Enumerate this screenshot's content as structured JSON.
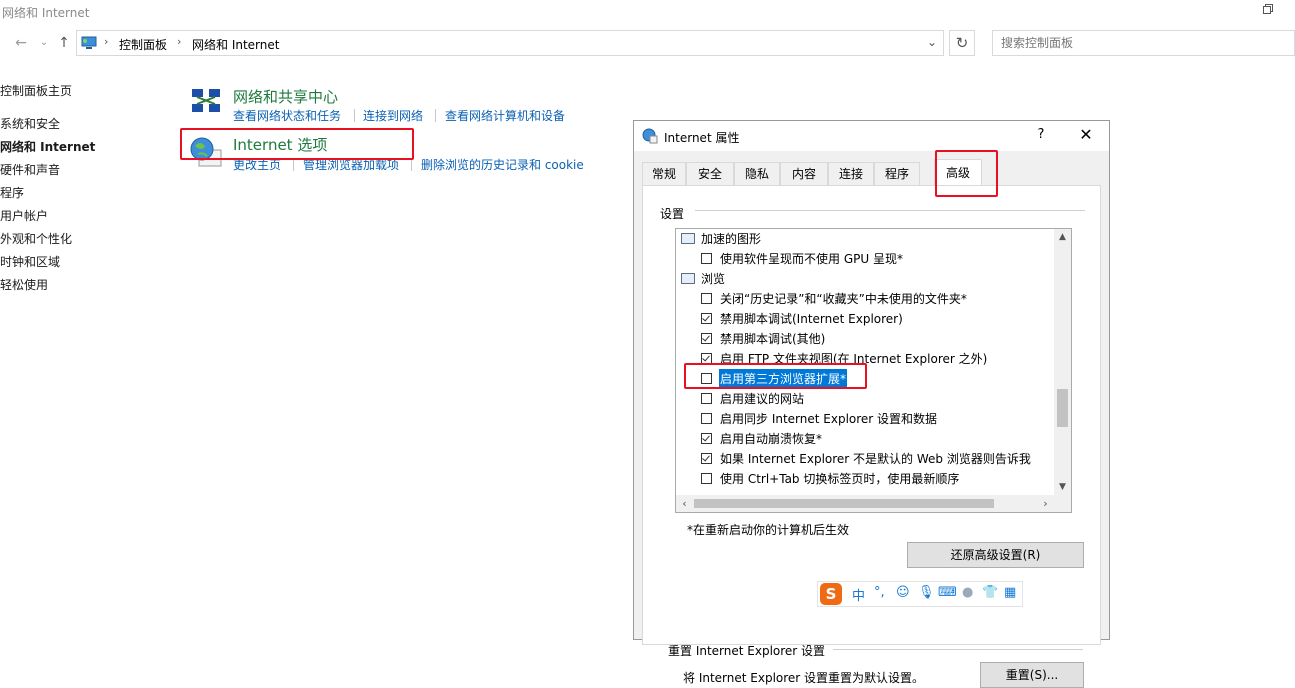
{
  "window": {
    "title": "网络和 Internet"
  },
  "address_bar": {
    "crumbs": [
      "控制面板",
      "网络和 Internet"
    ],
    "search_placeholder": "搜索控制面板"
  },
  "left_nav": {
    "items": [
      "控制面板主页",
      "系统和安全",
      "网络和 Internet",
      "硬件和声音",
      "程序",
      "用户帐户",
      "外观和个性化",
      "时钟和区域",
      "轻松使用"
    ]
  },
  "categories": [
    {
      "heading": "网络和共享中心",
      "links": [
        "查看网络状态和任务",
        "连接到网络",
        "查看网络计算机和设备"
      ]
    },
    {
      "heading": "Internet 选项",
      "links": [
        "更改主页",
        "管理浏览器加载项",
        "删除浏览的历史记录和 cookie"
      ]
    }
  ],
  "dialog": {
    "title": "Internet 属性",
    "help_label": "?",
    "close_label": "✕",
    "tabs": [
      "常规",
      "安全",
      "隐私",
      "内容",
      "连接",
      "程序",
      "高级"
    ],
    "active_tab": "高级",
    "settings_label": "设置",
    "tree": [
      {
        "type": "group",
        "label": "加速的图形"
      },
      {
        "type": "check",
        "label": "使用软件呈现而不使用 GPU 呈现*",
        "checked": false
      },
      {
        "type": "group",
        "label": "浏览"
      },
      {
        "type": "check",
        "label": "关闭“历史记录”和“收藏夹”中未使用的文件夹*",
        "checked": false
      },
      {
        "type": "check",
        "label": "禁用脚本调试(Internet Explorer)",
        "checked": true
      },
      {
        "type": "check",
        "label": "禁用脚本调试(其他)",
        "checked": true
      },
      {
        "type": "check",
        "label": "启用 FTP 文件夹视图(在 Internet Explorer 之外)",
        "checked": true
      },
      {
        "type": "check",
        "label": "启用第三方浏览器扩展*",
        "checked": false,
        "selected": true
      },
      {
        "type": "check",
        "label": "启用建议的网站",
        "checked": false
      },
      {
        "type": "check",
        "label": "启用同步 Internet Explorer 设置和数据",
        "checked": false
      },
      {
        "type": "check",
        "label": "启用自动崩溃恢复*",
        "checked": true
      },
      {
        "type": "check",
        "label": "如果 Internet Explorer 不是默认的 Web 浏览器则告诉我",
        "checked": true
      },
      {
        "type": "check",
        "label": "使用 Ctrl+Tab 切换标签页时，使用最新顺序",
        "checked": false
      }
    ],
    "restart_note": "*在重新启动你的计算机后生效",
    "restore_button": "还原高级设置(R)",
    "reset_section_label": "重置 Internet Explorer 设置",
    "reset_description": "将 Internet Explorer 设置重置为默认设置。",
    "reset_button": "重置(S)..."
  },
  "ime_toolbar": {
    "logo": "S",
    "mode": "中",
    "punct": "°,",
    "icons": [
      "emoji-icon",
      "microphone-icon",
      "keyboard-icon",
      "user-icon",
      "skin-icon",
      "toolbox-icon"
    ]
  },
  "colors": {
    "highlight": "#e81123",
    "link": "#0b61b3",
    "heading": "#1e7a3c",
    "selection": "#0078d7"
  }
}
